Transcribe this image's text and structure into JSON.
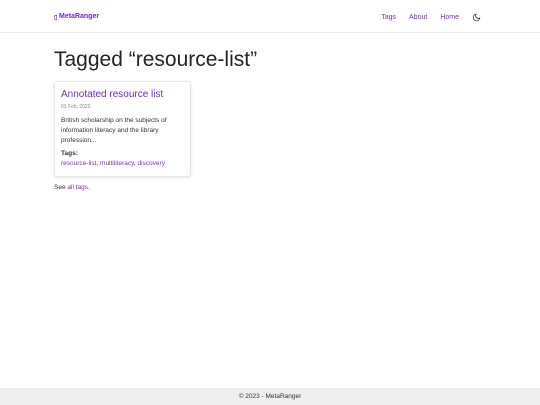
{
  "navbar": {
    "brand": "MetaRanger",
    "links": [
      "Tags",
      "About",
      "Home"
    ],
    "theme_toggle_icon": "moon-icon"
  },
  "main": {
    "title": "Tagged “resource-list”",
    "posts": [
      {
        "title": "Annotated resource list",
        "date": "03 Feb, 2022",
        "excerpt": "British scholarship on the subjects of information literacy and the library profession...",
        "tags_label": "Tags:",
        "tags": [
          "resource-list",
          "multiliteracy",
          "discovery"
        ]
      }
    ],
    "see_all_prefix": "See",
    "see_all_link": "all tags",
    "see_all_suffix": "."
  },
  "footer": {
    "text": "© 2023 - MetaRanger"
  },
  "colors": {
    "accent": "#6f2dbd",
    "link": "#7b2fbe",
    "footer_bg": "#efefef"
  }
}
